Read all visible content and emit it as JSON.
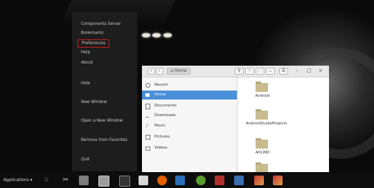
{
  "dock_menu": {
    "items": [
      {
        "label": "Components Server"
      },
      {
        "label": "Bookmarks"
      },
      {
        "label": "Preferences"
      },
      {
        "label": "Help"
      },
      {
        "label": "About"
      },
      {
        "label": "Hide"
      },
      {
        "label": "New Window"
      },
      {
        "label": "Open a New Window"
      },
      {
        "label": "Remove from Favorites"
      },
      {
        "label": "Quit"
      }
    ]
  },
  "file_manager": {
    "header": {
      "back_icon": "chevron-left-icon",
      "forward_icon": "chevron-right-icon",
      "path_label": "Home",
      "view_icons": [
        "search-icon",
        "grid-icon",
        "list-view-icon",
        "chevron-down-icon",
        "menu-icon"
      ],
      "window_controls": [
        "–",
        "□",
        "×"
      ]
    },
    "sidebar": [
      {
        "label": "Recent",
        "icon": "clock-icon"
      },
      {
        "label": "Home",
        "icon": "home-icon",
        "active": true
      },
      {
        "label": "Documents",
        "icon": "document-icon"
      },
      {
        "label": "Downloads",
        "icon": "download-icon"
      },
      {
        "label": "Music",
        "icon": "music-icon"
      },
      {
        "label": "Pictures",
        "icon": "picture-icon"
      },
      {
        "label": "Videos",
        "icon": "video-icon"
      }
    ],
    "files": [
      {
        "name": "Android"
      },
      {
        "name": "AndroidStudioProjects"
      },
      {
        "name": "AOLIND"
      }
    ]
  },
  "taskbar": {
    "applications_label": "Applications ▾",
    "icons": [
      "grid-icon",
      "tools-icon",
      "archive-icon",
      "terminal-icon",
      "file-manager-icon",
      "inbox-icon",
      "firefox-icon",
      "document-icon",
      "android-icon",
      "package-icon",
      "writer-icon",
      "brush-icon",
      "brush-icon"
    ]
  },
  "colors": {
    "accent": "#4a90d9",
    "highlight_border": "#d81e1e",
    "menu_bg": "#1e1e1e",
    "folder": "#c8bc8f"
  }
}
